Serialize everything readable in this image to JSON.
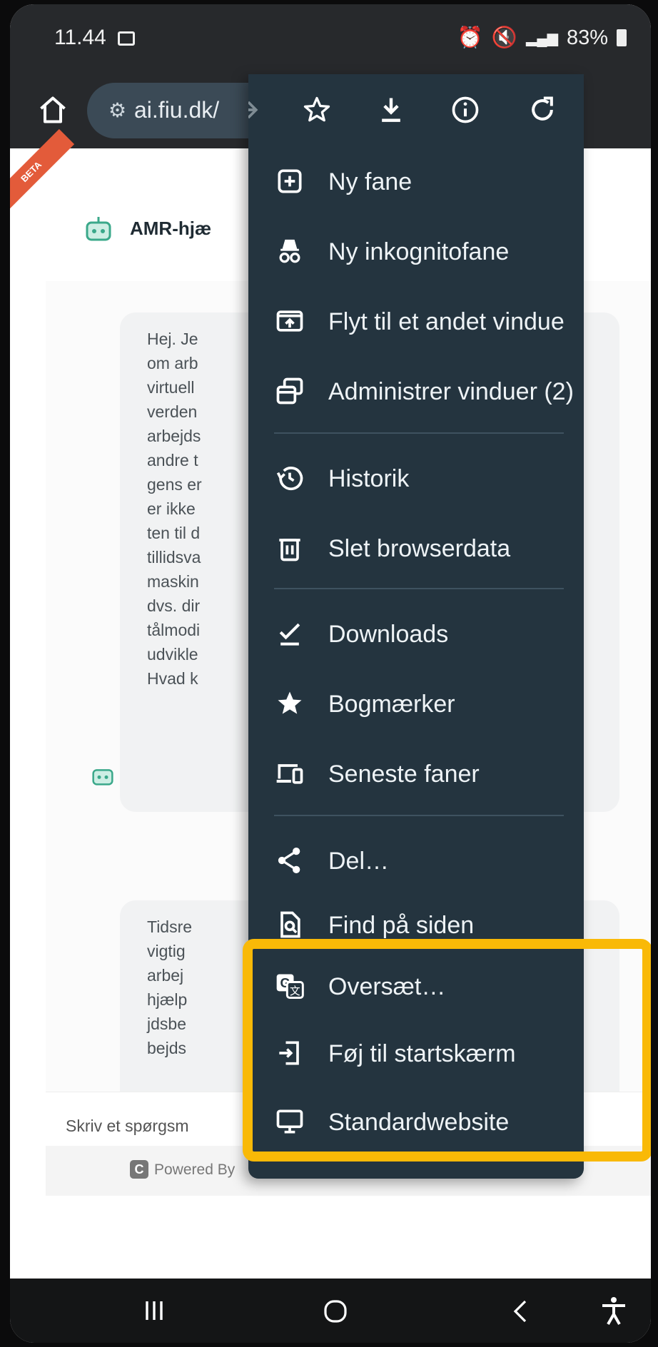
{
  "status_bar": {
    "time": "11.44",
    "battery": "83%"
  },
  "browser": {
    "url": "ai.fiu.dk/",
    "icons": [
      "home-icon",
      "site-settings-icon",
      "forward-icon",
      "star-icon",
      "download-icon",
      "info-icon",
      "reload-icon"
    ]
  },
  "page": {
    "beta_label": "BETA",
    "bot_title": "AMR-hjæ",
    "message1_lines": [
      "Hej. Je",
      "om arb",
      "virtuell",
      "verden",
      "arbejds",
      "andre t",
      "gens er",
      "er ikke",
      "ten til d",
      "tillidsva",
      "maskin",
      "dvs. dir",
      "tålmodi",
      "udvikle",
      "Hvad k"
    ],
    "message2_lines": [
      "Tidsre",
      "vigtig",
      "arbej",
      "hjælp",
      "jdsbe",
      "bejds"
    ],
    "input_placeholder": "Skriv et spørgsm",
    "footer_logo": "C",
    "footer_text": "Powered By"
  },
  "menu": {
    "items": [
      {
        "label": "Ny fane",
        "icon": "new-tab-icon"
      },
      {
        "label": "Ny inkognitofane",
        "icon": "incognito-icon"
      },
      {
        "label": "Flyt til et andet vindue",
        "icon": "move-window-icon"
      },
      {
        "label": "Administrer vinduer (2)",
        "icon": "manage-windows-icon"
      },
      {
        "label": "Historik",
        "icon": "history-icon"
      },
      {
        "label": "Slet browserdata",
        "icon": "trash-icon"
      },
      {
        "label": "Downloads",
        "icon": "downloads-check-icon"
      },
      {
        "label": "Bogmærker",
        "icon": "bookmark-star-icon"
      },
      {
        "label": "Seneste faner",
        "icon": "devices-icon"
      },
      {
        "label": "Del…",
        "icon": "share-icon"
      },
      {
        "label": "Find på siden",
        "icon": "find-in-page-icon"
      },
      {
        "label": "Oversæt…",
        "icon": "translate-icon"
      },
      {
        "label": "Føj til startskærm",
        "icon": "add-to-home-icon"
      },
      {
        "label": "Standardwebsite",
        "icon": "desktop-icon"
      }
    ],
    "highlight_color": "#f9b907"
  },
  "colors": {
    "menu_bg": "#24343f",
    "toolbar_bg": "#27292c",
    "accent_yellow": "#f9b907"
  }
}
